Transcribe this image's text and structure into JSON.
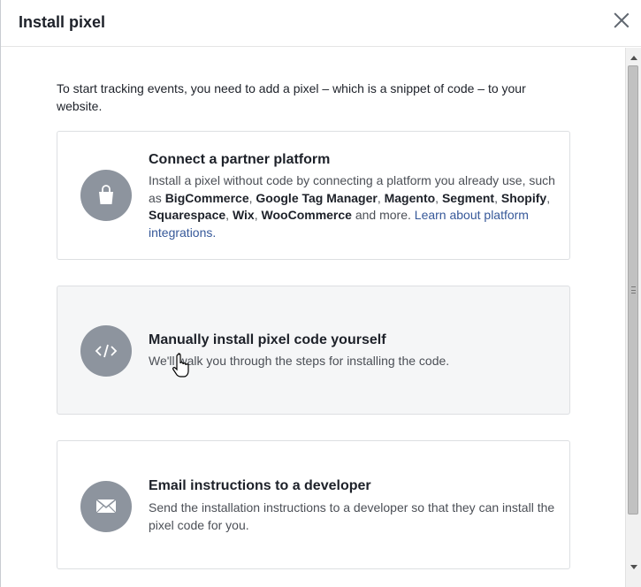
{
  "dialog": {
    "title": "Install pixel",
    "close_icon": "close-icon"
  },
  "intro": "To start tracking events, you need to add a pixel – which is a snippet of code – to your website.",
  "options": [
    {
      "title": "Connect a partner platform",
      "icon": "shopping-bag-icon",
      "desc_start": "Install a pixel without code by connecting a platform you already use, such as ",
      "platforms": [
        "BigCommerce",
        "Google Tag Manager",
        "Magento",
        "Segment",
        "Shopify",
        "Squarespace",
        "Wix",
        "WooCommerce"
      ],
      "desc_more": " and more. ",
      "link": "Learn about platform integrations."
    },
    {
      "title": "Manually install pixel code yourself",
      "icon": "code-icon",
      "desc": "We'll walk you through the steps for installing the code."
    },
    {
      "title": "Email instructions to a developer",
      "icon": "envelope-icon",
      "desc": "Send the installation instructions to a developer so that they can install the pixel code for you."
    }
  ],
  "colors": {
    "icon_circle": "#8d949e",
    "link": "#365899",
    "hover_card": "#f5f6f7"
  }
}
